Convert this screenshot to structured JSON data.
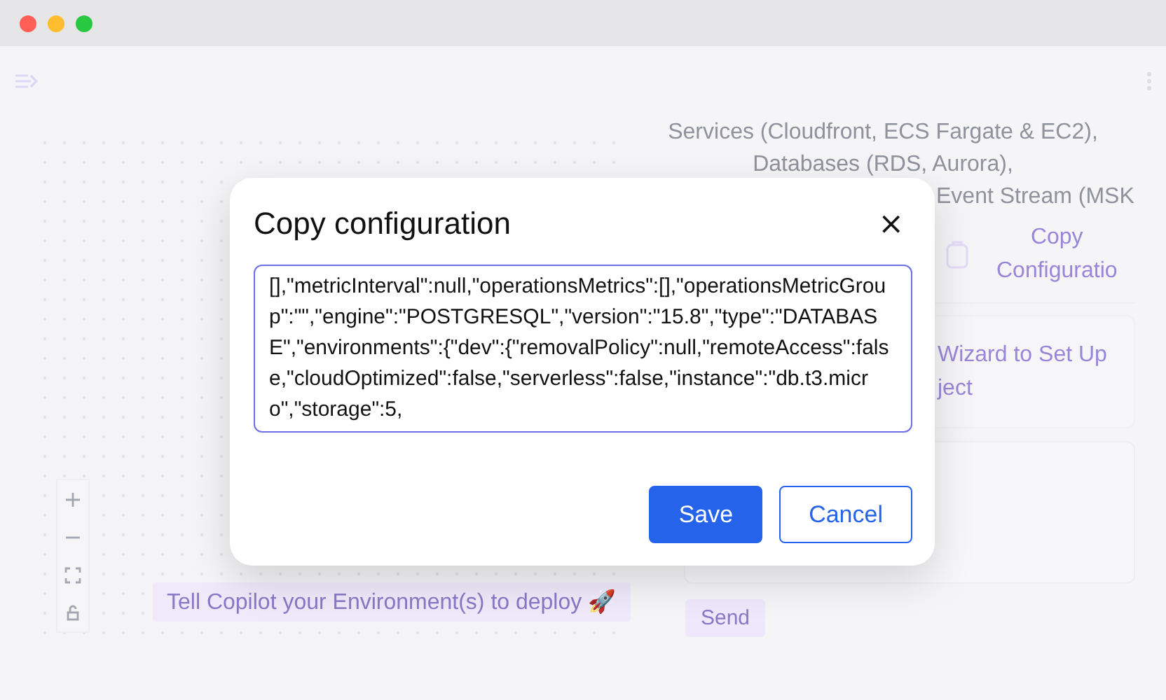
{
  "right_panel": {
    "summary_lines": [
      "Services (Cloudfront, ECS Fargate & EC2),",
      "Databases (RDS, Aurora),",
      "Event Stream (MSK"
    ],
    "copy_button": {
      "label_lines": [
        "Copy",
        "Configuratio"
      ]
    },
    "wizard_button": {
      "label_lines": [
        "Wizard to Set Up",
        "ject"
      ]
    },
    "send_button": {
      "label": "Send"
    }
  },
  "canvas": {
    "prompt_button": {
      "label": "Tell Copilot your Environment(s) to deploy 🚀"
    }
  },
  "modal": {
    "title": "Copy configuration",
    "close": "×",
    "config_text": "[],\"metricInterval\":null,\"operationsMetrics\":[],\"operationsMetricGroup\":\"\",\"engine\":\"POSTGRESQL\",\"version\":\"15.8\",\"type\":\"DATABASE\",\"environments\":{\"dev\":{\"removalPolicy\":null,\"remoteAccess\":false,\"cloudOptimized\":false,\"serverless\":false,\"instance\":\"db.t3.micro\",\"storage\":5,",
    "buttons": [
      {
        "label": "Save",
        "kind": "primary"
      },
      {
        "label": "Cancel",
        "kind": "secondary"
      }
    ]
  }
}
